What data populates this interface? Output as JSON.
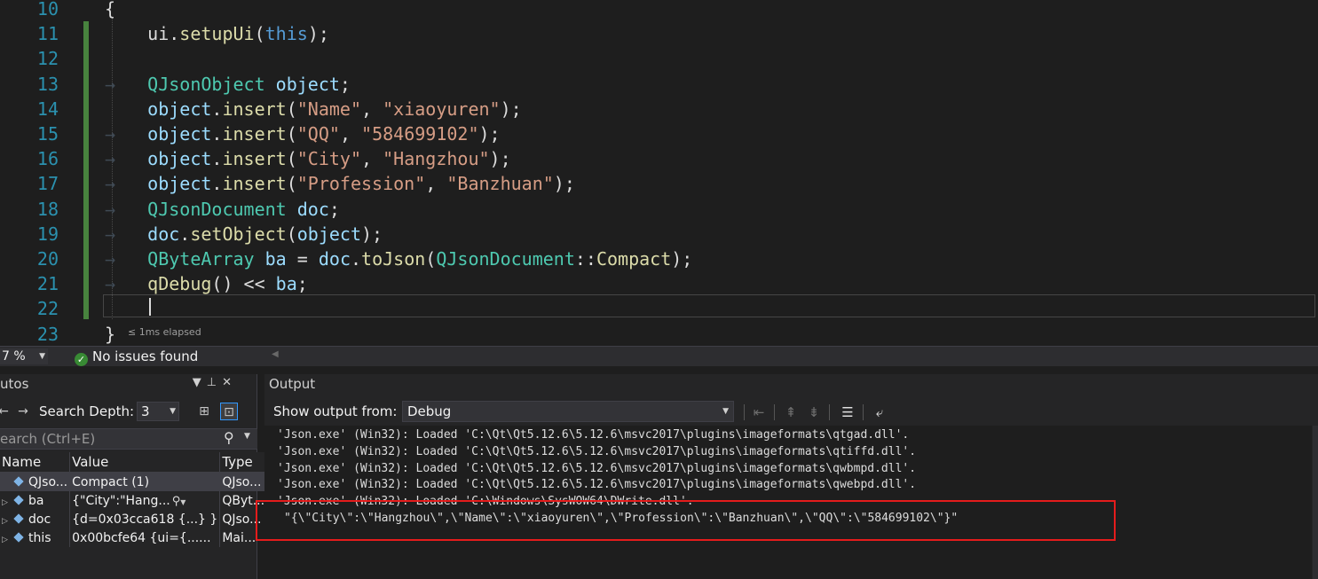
{
  "editor": {
    "lines": [
      {
        "n": "10",
        "segments": [
          {
            "t": "{",
            "c": "plain"
          }
        ]
      },
      {
        "n": "11",
        "segments": [
          {
            "t": "    ui.",
            "c": "plain"
          },
          {
            "t": "setupUi",
            "c": "fn"
          },
          {
            "t": "(",
            "c": "plain"
          },
          {
            "t": "this",
            "c": "kw"
          },
          {
            "t": ");",
            "c": "plain"
          }
        ]
      },
      {
        "n": "12",
        "segments": []
      },
      {
        "n": "13",
        "segments": [
          {
            "t": "→   ",
            "c": "tab"
          },
          {
            "t": "QJsonObject",
            "c": "type"
          },
          {
            "t": " ",
            "c": "plain"
          },
          {
            "t": "object",
            "c": "var"
          },
          {
            "t": ";",
            "c": "plain"
          }
        ]
      },
      {
        "n": "14",
        "segments": [
          {
            "t": "    ",
            "c": "plain"
          },
          {
            "t": "object",
            "c": "var"
          },
          {
            "t": ".",
            "c": "plain"
          },
          {
            "t": "insert",
            "c": "fn"
          },
          {
            "t": "(",
            "c": "plain"
          },
          {
            "t": "\"Name\"",
            "c": "str"
          },
          {
            "t": ", ",
            "c": "plain"
          },
          {
            "t": "\"xiaoyuren\"",
            "c": "str"
          },
          {
            "t": ");",
            "c": "plain"
          }
        ]
      },
      {
        "n": "15",
        "segments": [
          {
            "t": "→   ",
            "c": "tab"
          },
          {
            "t": "object",
            "c": "var"
          },
          {
            "t": ".",
            "c": "plain"
          },
          {
            "t": "insert",
            "c": "fn"
          },
          {
            "t": "(",
            "c": "plain"
          },
          {
            "t": "\"QQ\"",
            "c": "str"
          },
          {
            "t": ", ",
            "c": "plain"
          },
          {
            "t": "\"584699102\"",
            "c": "str"
          },
          {
            "t": ");",
            "c": "plain"
          }
        ]
      },
      {
        "n": "16",
        "segments": [
          {
            "t": "→   ",
            "c": "tab"
          },
          {
            "t": "object",
            "c": "var"
          },
          {
            "t": ".",
            "c": "plain"
          },
          {
            "t": "insert",
            "c": "fn"
          },
          {
            "t": "(",
            "c": "plain"
          },
          {
            "t": "\"City\"",
            "c": "str"
          },
          {
            "t": ", ",
            "c": "plain"
          },
          {
            "t": "\"Hangzhou\"",
            "c": "str"
          },
          {
            "t": ");",
            "c": "plain"
          }
        ]
      },
      {
        "n": "17",
        "segments": [
          {
            "t": "→   ",
            "c": "tab"
          },
          {
            "t": "object",
            "c": "var"
          },
          {
            "t": ".",
            "c": "plain"
          },
          {
            "t": "insert",
            "c": "fn"
          },
          {
            "t": "(",
            "c": "plain"
          },
          {
            "t": "\"Profession\"",
            "c": "str"
          },
          {
            "t": ", ",
            "c": "plain"
          },
          {
            "t": "\"Banzhuan\"",
            "c": "str"
          },
          {
            "t": ");",
            "c": "plain"
          }
        ]
      },
      {
        "n": "18",
        "segments": [
          {
            "t": "→   ",
            "c": "tab"
          },
          {
            "t": "QJsonDocument",
            "c": "type"
          },
          {
            "t": " ",
            "c": "plain"
          },
          {
            "t": "doc",
            "c": "var"
          },
          {
            "t": ";",
            "c": "plain"
          }
        ]
      },
      {
        "n": "19",
        "segments": [
          {
            "t": "→   ",
            "c": "tab"
          },
          {
            "t": "doc",
            "c": "var"
          },
          {
            "t": ".",
            "c": "plain"
          },
          {
            "t": "setObject",
            "c": "fn"
          },
          {
            "t": "(",
            "c": "plain"
          },
          {
            "t": "object",
            "c": "var"
          },
          {
            "t": ");",
            "c": "plain"
          }
        ]
      },
      {
        "n": "20",
        "segments": [
          {
            "t": "→   ",
            "c": "tab"
          },
          {
            "t": "QByteArray",
            "c": "type"
          },
          {
            "t": " ",
            "c": "plain"
          },
          {
            "t": "ba",
            "c": "var"
          },
          {
            "t": " = ",
            "c": "plain"
          },
          {
            "t": "doc",
            "c": "var"
          },
          {
            "t": ".",
            "c": "plain"
          },
          {
            "t": "toJson",
            "c": "fn"
          },
          {
            "t": "(",
            "c": "plain"
          },
          {
            "t": "QJsonDocument",
            "c": "type"
          },
          {
            "t": "::",
            "c": "plain"
          },
          {
            "t": "Compact",
            "c": "fn"
          },
          {
            "t": ");",
            "c": "plain"
          }
        ]
      },
      {
        "n": "21",
        "segments": [
          {
            "t": "→   ",
            "c": "tab"
          },
          {
            "t": "qDebug",
            "c": "fn"
          },
          {
            "t": "() << ",
            "c": "plain"
          },
          {
            "t": "ba",
            "c": "var"
          },
          {
            "t": ";",
            "c": "plain"
          }
        ]
      },
      {
        "n": "22",
        "segments": []
      },
      {
        "n": "23",
        "segments": [
          {
            "t": "}",
            "c": "plain"
          }
        ]
      }
    ],
    "elapsed": "≤ 1ms elapsed"
  },
  "status": {
    "zoom": "7 %",
    "issues": "No issues found"
  },
  "autos": {
    "title": "utos",
    "search_depth_label": "Search Depth:",
    "search_depth_value": "3",
    "search_placeholder": "earch (Ctrl+E)",
    "columns": [
      "Name",
      "Value",
      "Type"
    ],
    "rows": [
      {
        "name": "QJso...",
        "value": "Compact (1)",
        "type": "QJso...",
        "expandable": false,
        "selected": true
      },
      {
        "name": "ba",
        "value": "{\"City\":\"Hang...",
        "type": "QByt...",
        "expandable": true,
        "selected": false
      },
      {
        "name": "doc",
        "value": "{d=0x03cca618 {...} }",
        "type": "QJso...",
        "expandable": true,
        "selected": false
      },
      {
        "name": "this",
        "value": "0x00bcfe64 {ui={......",
        "type": "Mai...",
        "expandable": true,
        "selected": false
      }
    ]
  },
  "output": {
    "title": "Output",
    "show_label": "Show output from:",
    "source": "Debug",
    "lines": [
      "'Json.exe' (Win32): Loaded 'C:\\Qt\\Qt5.12.6\\5.12.6\\msvc2017\\plugins\\imageformats\\qtgad.dll'.",
      "'Json.exe' (Win32): Loaded 'C:\\Qt\\Qt5.12.6\\5.12.6\\msvc2017\\plugins\\imageformats\\qtiffd.dll'.",
      "'Json.exe' (Win32): Loaded 'C:\\Qt\\Qt5.12.6\\5.12.6\\msvc2017\\plugins\\imageformats\\qwbmpd.dll'.",
      "'Json.exe' (Win32): Loaded 'C:\\Qt\\Qt5.12.6\\5.12.6\\msvc2017\\plugins\\imageformats\\qwebpd.dll'.",
      "'Json.exe' (Win32): Loaded 'C:\\Windows\\SysWOW64\\DWrite.dll'.",
      "\"{\\\"City\\\":\\\"Hangzhou\\\",\\\"Name\\\":\\\"xiaoyuren\\\",\\\"Profession\\\":\\\"Banzhuan\\\",\\\"QQ\\\":\\\"584699102\\\"}\""
    ]
  },
  "colors": {
    "highlight_box": "#e51c1c",
    "change_bar": "#57a64a",
    "line_number": "#2b91af"
  }
}
